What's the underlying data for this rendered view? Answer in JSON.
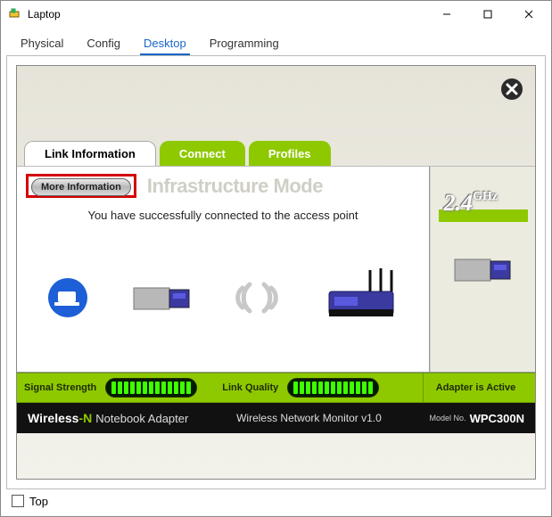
{
  "window": {
    "title": "Laptop"
  },
  "app_tabs": [
    "Physical",
    "Config",
    "Desktop",
    "Programming"
  ],
  "active_app_tab": 2,
  "monitor": {
    "tabs": [
      "Link Information",
      "Connect",
      "Profiles"
    ],
    "active_tab": 0,
    "more_info_label": "More Information",
    "mode_title": "Infrastructure Mode",
    "success_message": "You have successfully connected to the access point",
    "frequency_value": "2.4",
    "frequency_unit": "GHz",
    "signal_strength_label": "Signal Strength",
    "link_quality_label": "Link Quality",
    "adapter_status": "Adapter is Active",
    "brand_a": "Wireless",
    "brand_b": "-N",
    "product": "Notebook Adapter",
    "monitor_name": "Wireless Network Monitor  v1.0",
    "model_label": "Model No.",
    "model_no": "WPC300N",
    "signal_segments": 13,
    "quality_segments": 13
  },
  "bottom": {
    "top_label": "Top"
  }
}
